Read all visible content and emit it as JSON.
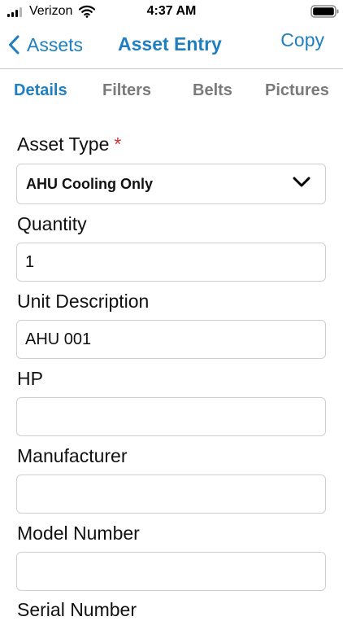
{
  "status_bar": {
    "carrier": "Verizon",
    "time": "4:37 AM",
    "signal_icon": "cellular-signal-icon",
    "wifi_icon": "wifi-icon",
    "battery_icon": "battery-icon"
  },
  "nav": {
    "back_label": "Assets",
    "title": "Asset Entry",
    "copy_label": "Copy",
    "accent_color": "#1f7fbf"
  },
  "tabs": [
    {
      "label": "Details",
      "active": true
    },
    {
      "label": "Filters",
      "active": false
    },
    {
      "label": "Belts",
      "active": false
    },
    {
      "label": "Pictures",
      "active": false
    }
  ],
  "form": {
    "asset_type": {
      "label": "Asset Type",
      "required_mark": "*",
      "value": "AHU Cooling Only"
    },
    "quantity": {
      "label": "Quantity",
      "value": "1"
    },
    "unit_description": {
      "label": "Unit Description",
      "value": "AHU 001"
    },
    "hp": {
      "label": "HP",
      "value": ""
    },
    "manufacturer": {
      "label": "Manufacturer",
      "value": ""
    },
    "model_number": {
      "label": "Model Number",
      "value": ""
    },
    "serial_number": {
      "label": "Serial Number"
    }
  }
}
